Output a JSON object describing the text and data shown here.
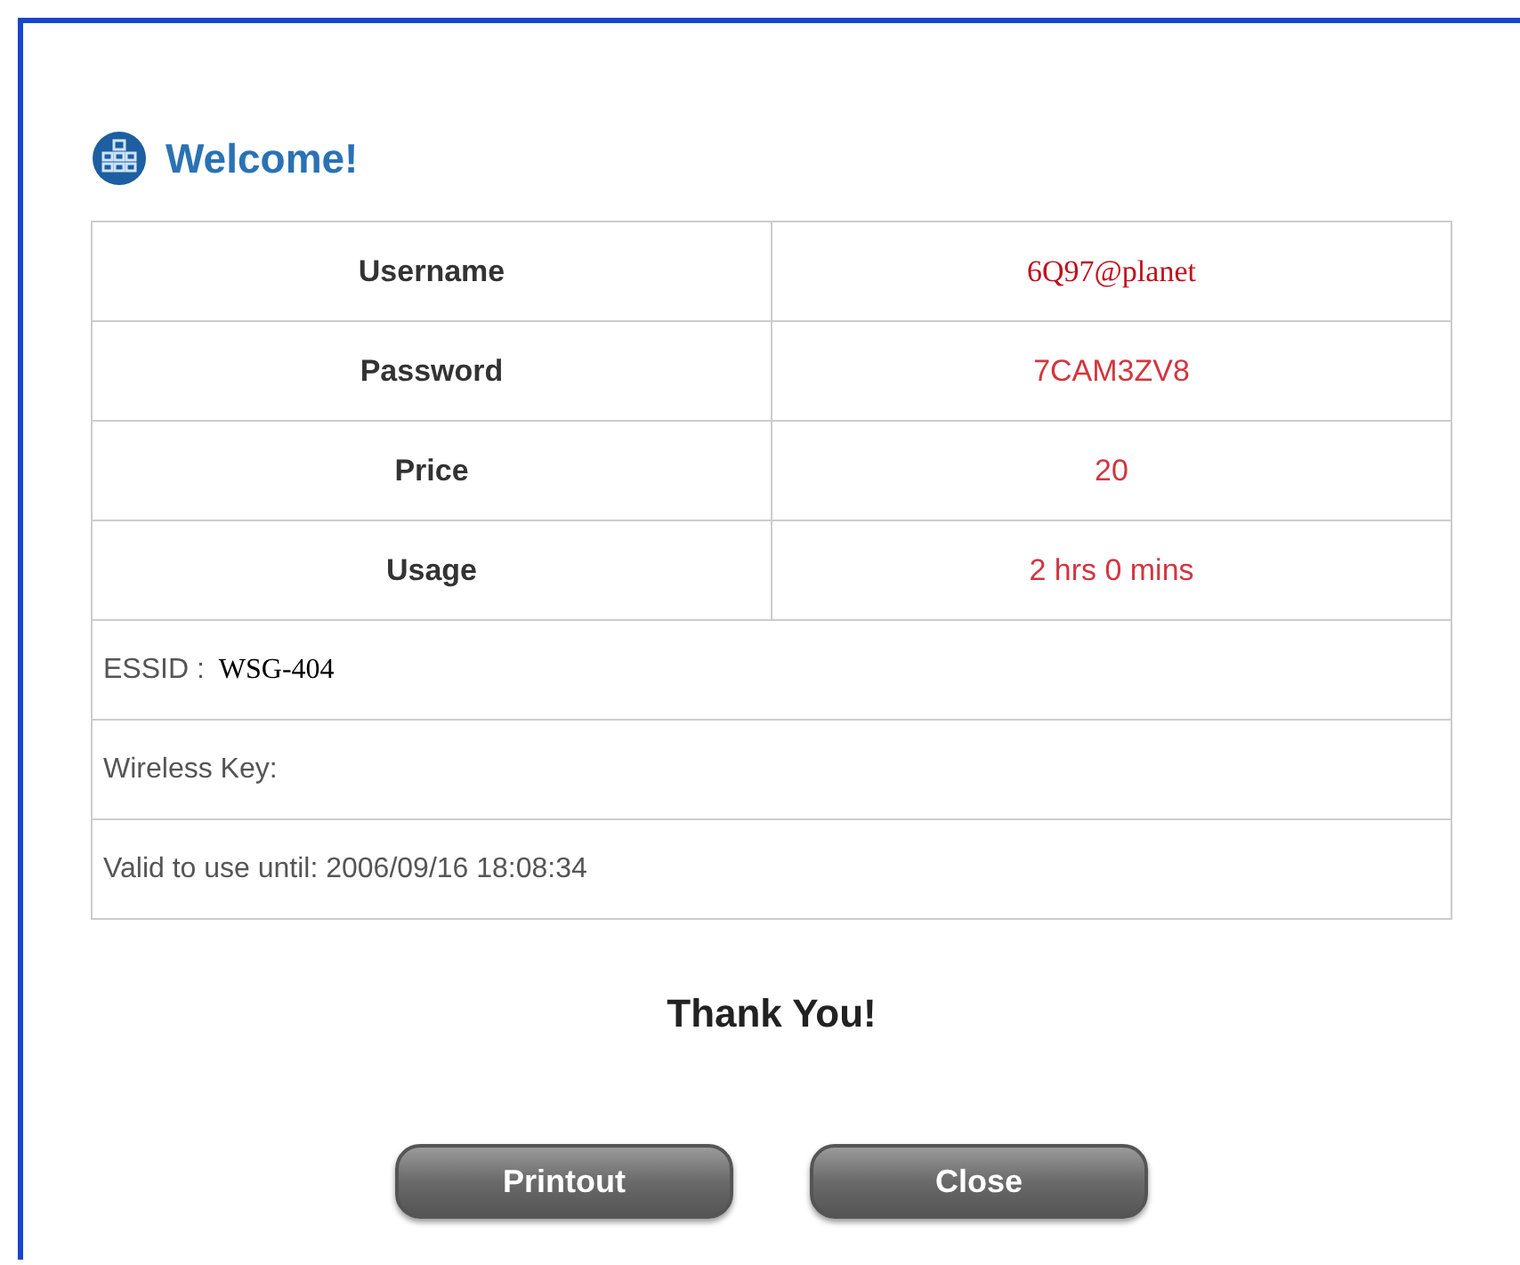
{
  "title": "Welcome!",
  "credentials": [
    {
      "label": "Username",
      "value": "6Q97@planet",
      "kind": "serif"
    },
    {
      "label": "Password",
      "value": "7CAM3ZV8",
      "kind": "sans"
    },
    {
      "label": "Price",
      "value": "20",
      "kind": "sans"
    },
    {
      "label": "Usage",
      "value": "2 hrs 0 mins",
      "kind": "sans"
    }
  ],
  "info": [
    {
      "label": "ESSID :",
      "value": "WSG-404"
    },
    {
      "label": "Wireless Key:"
    },
    {
      "label": "Valid to use until: 2006/09/16 18:08:34"
    }
  ],
  "message": "Thank You!",
  "buttons": [
    "Printout",
    "Close"
  ]
}
